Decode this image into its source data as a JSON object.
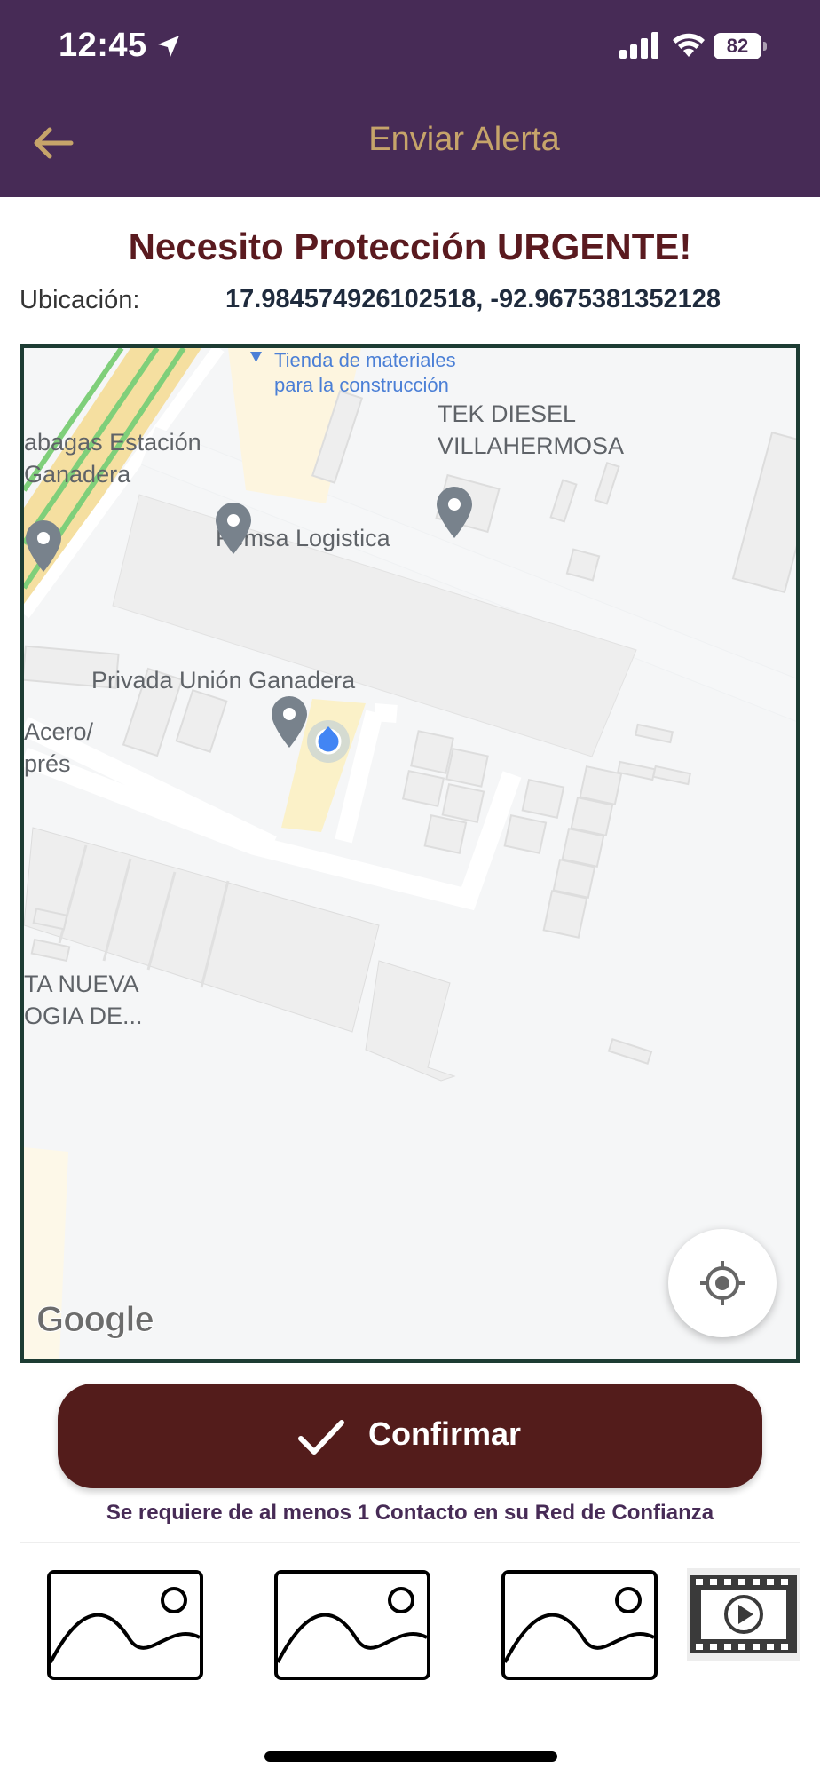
{
  "status_bar": {
    "time": "12:45",
    "battery": "82"
  },
  "header": {
    "title": "Enviar Alerta"
  },
  "alert": {
    "title": "Necesito Protección URGENTE!",
    "location_label": "Ubicación:",
    "location_value": "17.984574926102518, -92.9675381352128"
  },
  "map": {
    "labels": {
      "tienda": "Tienda de materiales\npara la construcción",
      "tek": "TEK DIESEL\nVILLAHERMOSA",
      "gas_station": "abagas Estación\nGanadera",
      "femsa": "Femsa Logistica",
      "privada": "Privada Unión Ganadera",
      "acero": "Acero/\nprés",
      "nueva": "TA NUEVA\nOGIA DE..."
    },
    "attribution": "Google"
  },
  "actions": {
    "confirm_label": "Confirmar",
    "requirement_text": "Se requiere de al menos 1 Contacto en su Red de Confianza"
  }
}
